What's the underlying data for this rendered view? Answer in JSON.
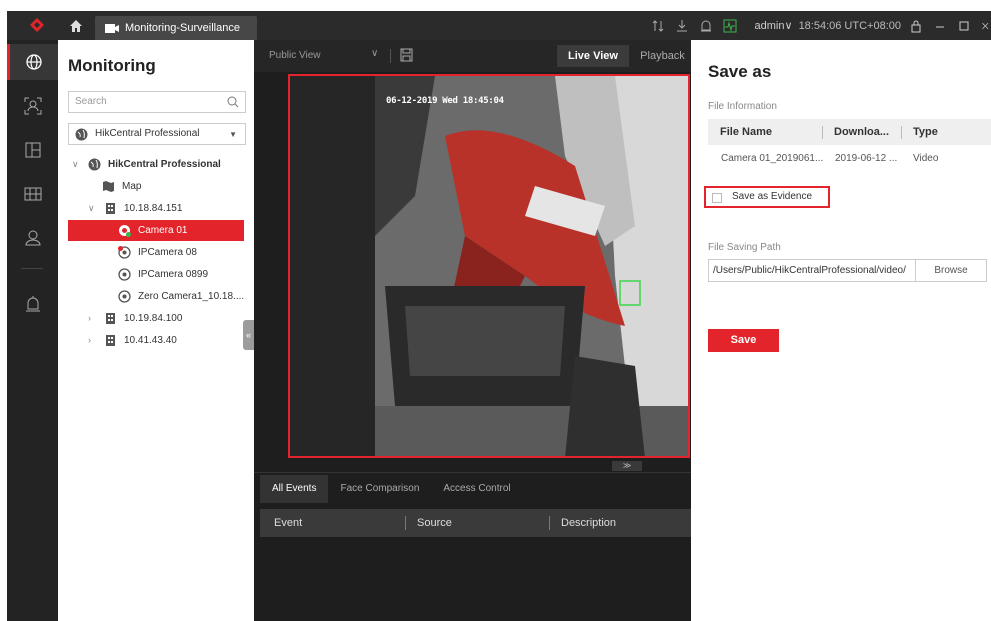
{
  "titlebar": {
    "tab_label": "Monitoring-Surveillance",
    "user": "admin",
    "user_caret": "∨",
    "time": "18:54:06 UTC+08:00"
  },
  "rail": {
    "items": [
      {
        "icon": "globe-icon",
        "active": true
      },
      {
        "icon": "face-scan-icon",
        "active": false
      },
      {
        "icon": "layout-icon",
        "active": false
      },
      {
        "icon": "grid-icon",
        "active": false
      },
      {
        "icon": "person-icon",
        "active": false
      },
      {
        "icon": "alarm-icon",
        "active": false
      }
    ]
  },
  "tree": {
    "title": "Monitoring",
    "search_placeholder": "Search",
    "site_selector": "HikCentral Professional",
    "nodes": [
      {
        "label": "HikCentral Professional",
        "icon": "globe-icon"
      },
      {
        "label": "Map",
        "icon": "map-icon"
      },
      {
        "label": "10.18.84.151",
        "icon": "building-icon"
      },
      {
        "label": "Camera 01",
        "icon": "camera-icon",
        "selected": true
      },
      {
        "label": "IPCamera 08",
        "icon": "camera-icon"
      },
      {
        "label": "IPCamera 0899",
        "icon": "camera-icon"
      },
      {
        "label": "Zero Camera1_10.18....",
        "icon": "camera-icon"
      },
      {
        "label": "10.19.84.100",
        "icon": "building-icon"
      },
      {
        "label": "10.41.43.40",
        "icon": "building-icon"
      }
    ],
    "collapse_glyph": "«"
  },
  "liveview": {
    "view_selector": "Public View",
    "tab_live": "Live View",
    "tab_playback": "Playback",
    "osd_text": "06-12-2019 Wed 18:45:04"
  },
  "events": {
    "tabs": [
      "All Events",
      "Face Comparison",
      "Access Control"
    ],
    "columns": [
      "Event",
      "Source",
      "Description"
    ]
  },
  "dialog": {
    "title": "Save as",
    "file_info_label": "File Information",
    "columns": [
      "File Name",
      "Downloa...",
      "Type"
    ],
    "row": [
      "Camera 01_2019061...",
      "2019-06-12 ...",
      "Video"
    ],
    "evidence_label": "Save as Evidence",
    "path_label": "File Saving Path",
    "path_value": "/Users/Public/HikCentralProfessional/video/",
    "browse_label": "Browse",
    "save_label": "Save"
  },
  "colors": {
    "accent": "#e3242b",
    "dark_bg": "#1e1e1e",
    "titlebar": "#2b2b2b"
  }
}
